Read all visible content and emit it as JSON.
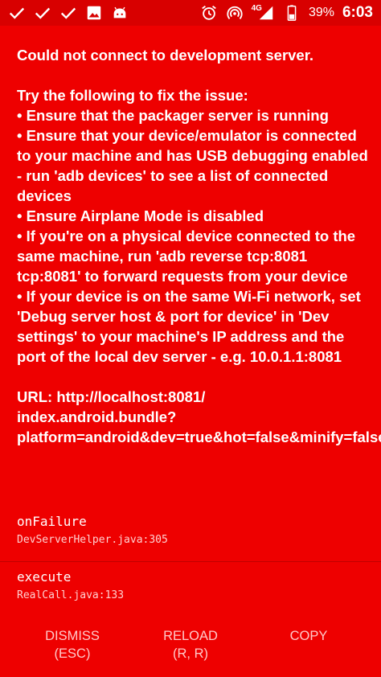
{
  "status_bar": {
    "icons_left": [
      "check-icon",
      "check-icon",
      "check-icon",
      "image-icon",
      "android-icon"
    ],
    "icons_right": [
      "alarm-icon",
      "hotspot-icon",
      "signal-icon",
      "battery-icon"
    ],
    "network_type": "4G",
    "battery": "39%",
    "time": "6:03"
  },
  "redbox": {
    "background": "#ee0000",
    "message": "Could not connect to development server.\n\nTry the following to fix the issue:\n• Ensure that the packager server is running\n• Ensure that your device/emulator is connected to your machine and has USB debugging enabled - run 'adb devices' to see a list of connected devices\n• Ensure Airplane Mode is disabled\n• If you're on a physical device connected to the same machine, run 'adb reverse tcp:8081 tcp:8081' to forward requests from your device\n• If your device is on the same Wi-Fi network, set 'Debug server host & port for device' in 'Dev settings' to your machine's IP address and the port of the local dev server - e.g. 10.0.1.1:8081\n\nURL: http://localhost:8081/\nindex.android.bundle?platform=android&dev=true&hot=false&minify=false",
    "stack": [
      {
        "method": "onFailure",
        "file": "DevServerHelper.java:305"
      },
      {
        "method": "execute",
        "file": "RealCall.java:133"
      }
    ],
    "buttons": {
      "dismiss": "DISMISS\n(ESC)",
      "reload": "RELOAD\n(R, R)",
      "copy": "COPY"
    }
  }
}
